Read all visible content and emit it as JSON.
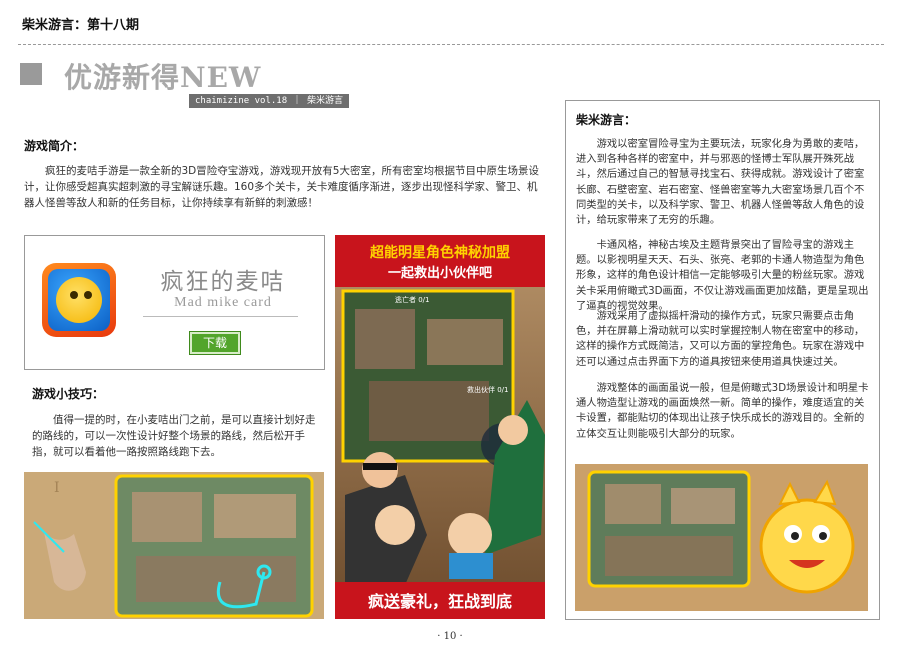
{
  "header": {
    "title": "柴米游言：第十八期"
  },
  "section": {
    "title": "优游新得NEW",
    "vol_tag": "chaimizine vol.18 ｜ 柴米游言"
  },
  "intro": {
    "heading": "游戏简介：",
    "body": "疯狂的麦咭手游是一款全新的3D冒险夺宝游戏，游戏现开放有5大密室，所有密室均根据节目中原生场景设计，让你感受超真实超刺激的寻宝解谜乐趣。160多个关卡，关卡难度循序渐进，逐步出现怪科学家、警卫、机器人怪兽等敌人和新的任务目标，让你持续享有新鲜的刺激感！"
  },
  "app_card": {
    "name_cn": "疯狂的麦咭",
    "name_en": "Mad mike card",
    "download_label": "下载"
  },
  "poster": {
    "top_line1": "超能明星角色神秘加盟",
    "top_line2": "一起救出小伙伴吧",
    "bottom_text": "疯送豪礼，狂战到底",
    "game_hud_1": "逃亡者 0/1",
    "game_hud_2": "救出伙伴 0/1"
  },
  "tips": {
    "heading": "游戏小技巧：",
    "body": "值得一提的时，在小麦咭出门之前，是可以直接计划好走的路线的，可以一次性设计好整个场景的路线，然后松开手指，就可以看着他一路按照路线跑下去。"
  },
  "sidebar": {
    "heading": "柴米游言：",
    "paragraphs": [
      "游戏以密室冒险寻宝为主要玩法，玩家化身为勇敢的麦咭，进入到各种各样的密室中，并与邪恶的怪博士军队展开殊死战斗，然后通过自己的智慧寻找宝石、获得成就。游戏设计了密室长廊、石壁密室、岩石密室、怪兽密室等九大密室场景几百个不同类型的关卡，以及科学家、警卫、机器人怪兽等敌人角色的设计，给玩家带来了无穷的乐趣。",
      "卡通风格，神秘古埃及主题背景突出了冒险寻宝的游戏主题。以影视明星天天、石头、张亮、老郭的卡通人物造型为角色形象，这样的角色设计相信一定能够吸引大量的粉丝玩家。游戏关卡采用俯瞰式3D画面，不仅让游戏画面更加炫酷，更是呈现出了逼真的视觉效果。",
      "游戏采用了虚拟摇杆滑动的操作方式，玩家只需要点击角色，并在屏幕上滑动就可以实时掌握控制人物在密室中的移动，这样的操作方式既简洁，又可以方面的掌控角色。玩家在游戏中还可以通过点击界面下方的道具按钮来使用道具快速过关。",
      "游戏整体的画面虽说一般，但是俯瞰式3D场景设计和明星卡通人物造型让游戏的画面焕然一新。简单的操作，难度适宜的关卡设置，都能贴切的体现出让孩子快乐成长的游戏目的。全新的立体交互让则能吸引大部分的玩家。"
    ]
  },
  "page_number": "· 10 ·",
  "colors": {
    "accent_gray": "#a8a8a8",
    "tag_bg": "#6e6e6e",
    "download_green": "#52a52b",
    "poster_red": "#c8141c",
    "poster_yellow": "#ffd200"
  }
}
